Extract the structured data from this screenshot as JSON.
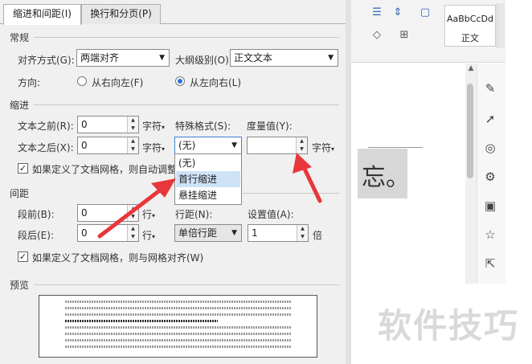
{
  "dialog": {
    "tabs": [
      {
        "label": "缩进和间距(I)",
        "active": true
      },
      {
        "label": "换行和分页(P)",
        "active": false
      }
    ],
    "general": {
      "title": "常规",
      "alignment_label": "对齐方式(G):",
      "alignment_value": "两端对齐",
      "outline_label": "大纲级别(O):",
      "outline_value": "正文文本",
      "direction_label": "方向:",
      "rtl_label": "从右向左(F)",
      "ltr_label": "从左向右(L)",
      "direction_selected": "ltr"
    },
    "indent": {
      "title": "缩进",
      "before_label": "文本之前(R):",
      "before_value": "0",
      "before_unit": "字符",
      "after_label": "文本之后(X):",
      "after_value": "0",
      "after_unit": "字符",
      "special_label": "特殊格式(S):",
      "special_value": "(无)",
      "measure_label": "度量值(Y):",
      "measure_value": "",
      "measure_unit": "字符",
      "grid_checkbox_label": "如果定义了文档网格，则自动调整",
      "grid_checked": true,
      "special_options": [
        "(无)",
        "首行缩进",
        "悬挂缩进"
      ],
      "highlighted_option": "首行缩进"
    },
    "spacing": {
      "title": "间距",
      "before_label": "段前(B):",
      "before_value": "0",
      "before_unit": "行",
      "after_label": "段后(E):",
      "after_value": "0",
      "after_unit": "行",
      "line_label": "行距(N):",
      "line_value": "单倍行距",
      "setting_label": "设置值(A):",
      "setting_value": "1",
      "setting_unit": "倍",
      "grid_checkbox_label": "如果定义了文档网格，则与网格对齐(W)",
      "grid_checked": true
    },
    "preview": {
      "title": "预览"
    }
  },
  "background": {
    "style_sample": "AaBbCcDd",
    "style_name": "正文",
    "doc_glyph": "忘。",
    "watermark": "软件技巧"
  },
  "colors": {
    "accent": "#2b6fd6",
    "arrow": "#e8373b",
    "highlight": "#cfe3f7"
  }
}
